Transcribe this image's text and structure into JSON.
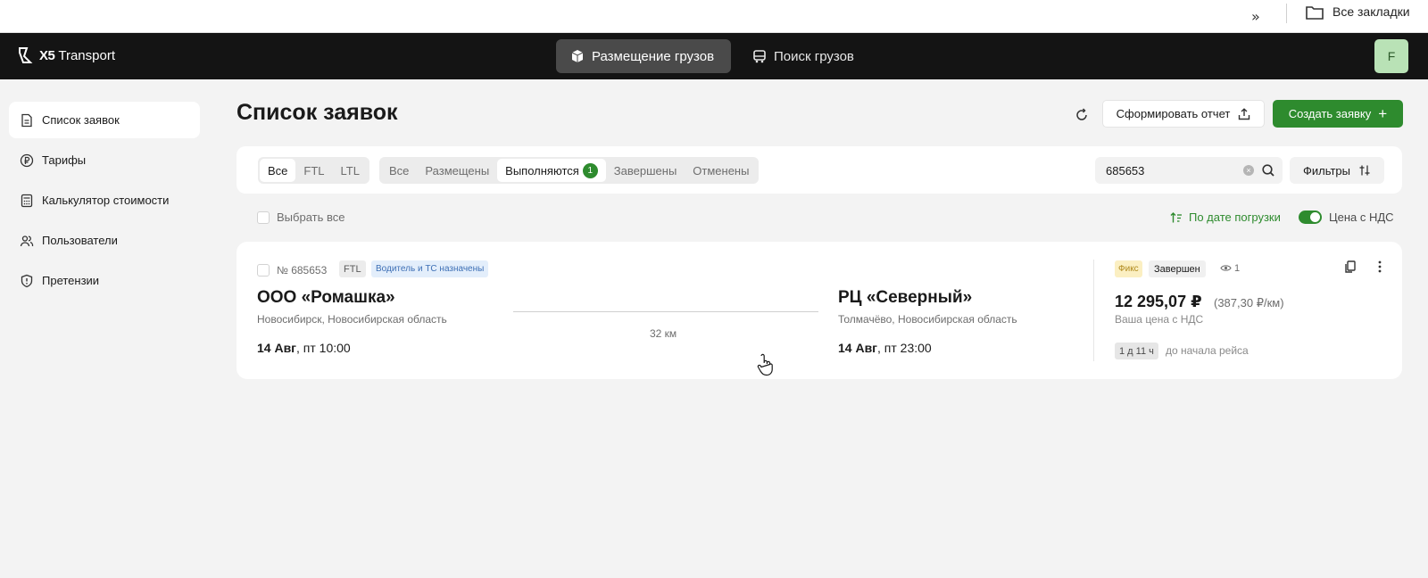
{
  "browser": {
    "bookmarks_label": "Все закладки"
  },
  "header": {
    "logo_brand": "X5",
    "logo_text": "Transport",
    "tabs": [
      {
        "label": "Размещение грузов",
        "active": true
      },
      {
        "label": "Поиск грузов",
        "active": false
      }
    ],
    "avatar_initial": "F"
  },
  "sidebar": {
    "items": [
      {
        "label": "Список заявок",
        "active": true
      },
      {
        "label": "Тарифы"
      },
      {
        "label": "Калькулятор стоимости"
      },
      {
        "label": "Пользователи"
      },
      {
        "label": "Претензии"
      }
    ]
  },
  "main": {
    "title": "Список заявок",
    "report_label": "Сформировать отчет",
    "create_label": "Создать заявку"
  },
  "filters": {
    "type_tabs": [
      "Все",
      "FTL",
      "LTL"
    ],
    "status_tabs": [
      "Все",
      "Размещены",
      "Выполняются",
      "Завершены",
      "Отменены"
    ],
    "status_badge": "1",
    "search_value": "685653",
    "filters_label": "Фильтры"
  },
  "list": {
    "select_all_label": "Выбрать все",
    "sort_label": "По дате погрузки",
    "vat_label": "Цена с НДС"
  },
  "order": {
    "number": "№ 685653",
    "type_tag": "FTL",
    "status_tag": "Водитель и ТС назначены",
    "from": {
      "name": "ООО «Ромашка»",
      "city": "Новосибирск, Новосибирская область",
      "date": "14 Авг",
      "time": ", пт 10:00"
    },
    "distance": "32 км",
    "to": {
      "name": "РЦ «Северный»",
      "city": "Толмачёво, Новосибирская область",
      "date": "14 Авг",
      "time": ", пт 23:00"
    },
    "price_type_tag": "Фикс",
    "state_tag": "Завершен",
    "views": "1",
    "price": "12 295,07 ₽",
    "price_per_km": "(387,30 ₽/км)",
    "price_caption": "Ваша цена с НДС",
    "time_to_start": "1 д 11 ч",
    "time_caption": "до начала рейса"
  },
  "colors": {
    "accent": "#2e8b2e",
    "header_bg": "#141414",
    "page_bg": "#f3f3f3"
  }
}
